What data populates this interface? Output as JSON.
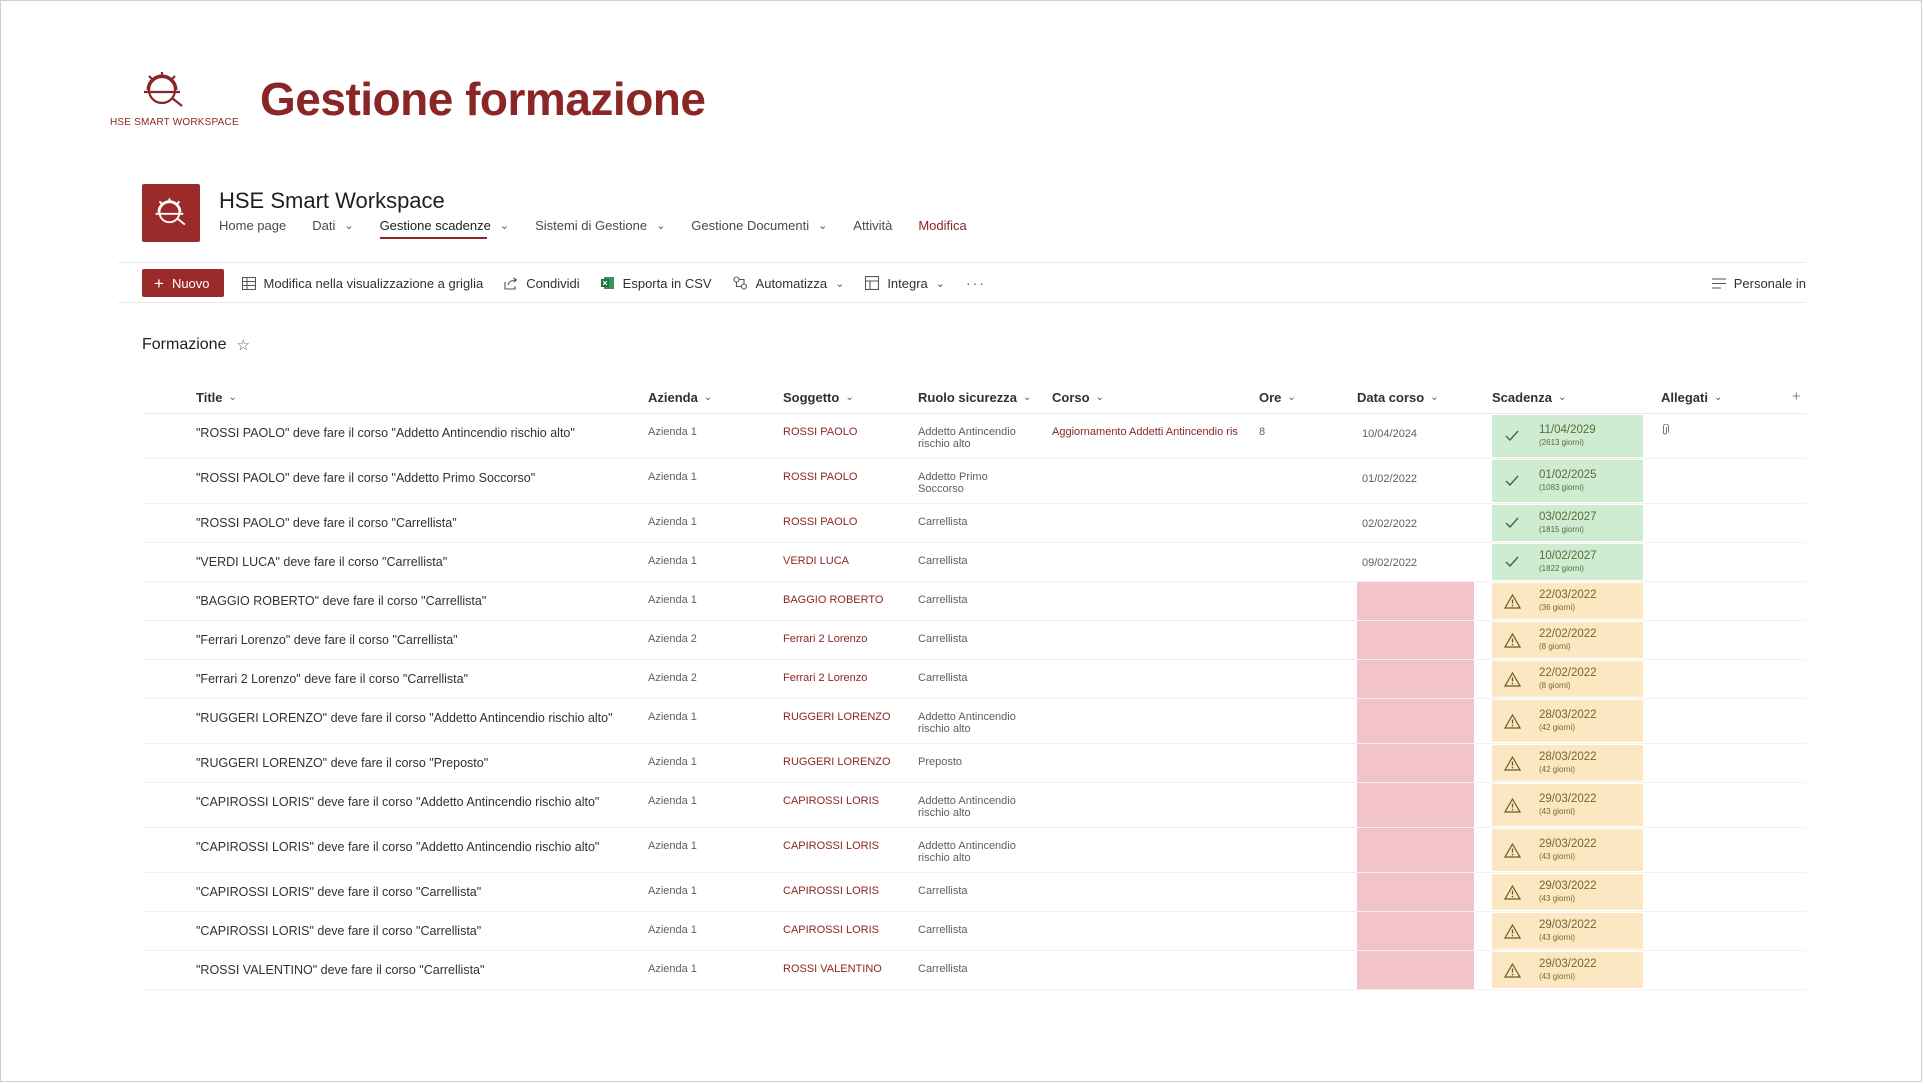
{
  "brand": {
    "text": "HSE SMART WORKSPACE"
  },
  "page_heading": "Gestione formazione",
  "site": {
    "title": "HSE Smart Workspace",
    "nav": [
      {
        "label": "Home page",
        "has_menu": false
      },
      {
        "label": "Dati",
        "has_menu": true
      },
      {
        "label": "Gestione scadenze",
        "has_menu": true,
        "active": true
      },
      {
        "label": "Sistemi di Gestione",
        "has_menu": true
      },
      {
        "label": "Gestione Documenti",
        "has_menu": true
      },
      {
        "label": "Attività",
        "has_menu": false
      },
      {
        "label": "Modifica",
        "has_menu": false
      }
    ]
  },
  "commands": {
    "new": "Nuovo",
    "grid_edit": "Modifica nella visualizzazione a griglia",
    "share": "Condividi",
    "export": "Esporta in CSV",
    "automate": "Automatizza",
    "integrate": "Integra",
    "more": "···",
    "view": "Personale in"
  },
  "list": {
    "title": "Formazione",
    "columns": {
      "title": "Title",
      "azienda": "Azienda",
      "soggetto": "Soggetto",
      "ruolo": "Ruolo sicurezza",
      "corso": "Corso",
      "ore": "Ore",
      "data": "Data corso",
      "scadenza": "Scadenza",
      "allegati": "Allegati",
      "add": "+"
    },
    "rows": [
      {
        "title": "\"ROSSI PAOLO\" deve fare il corso \"Addetto Antincendio rischio alto\"",
        "azienda": "Azienda 1",
        "soggetto": "ROSSI PAOLO",
        "ruolo": "Addetto Antincendio rischio alto",
        "corso": "Aggiornamento Addetti Antincendio ris",
        "ore": "8",
        "data": "10/04/2024",
        "scadenza": "11/04/2029",
        "giorni": "(2613 giorni)",
        "status": "ok",
        "allegato": true,
        "tall": true
      },
      {
        "title": "\"ROSSI PAOLO\" deve fare il corso \"Addetto Primo Soccorso\"",
        "azienda": "Azienda 1",
        "soggetto": "ROSSI PAOLO",
        "ruolo": "Addetto Primo Soccorso",
        "corso": "",
        "ore": "",
        "data": "01/02/2022",
        "scadenza": "01/02/2025",
        "giorni": "(1083 giorni)",
        "status": "ok",
        "allegato": false,
        "tall": true
      },
      {
        "title": "\"ROSSI PAOLO\" deve fare il corso \"Carrellista\"",
        "azienda": "Azienda 1",
        "soggetto": "ROSSI PAOLO",
        "ruolo": "Carrellista",
        "corso": "",
        "ore": "",
        "data": "02/02/2022",
        "scadenza": "03/02/2027",
        "giorni": "(1815 giorni)",
        "status": "ok",
        "allegato": false,
        "tall": false
      },
      {
        "title": "\"VERDI LUCA\" deve fare il corso \"Carrellista\"",
        "azienda": "Azienda 1",
        "soggetto": "VERDI LUCA",
        "ruolo": "Carrellista",
        "corso": "",
        "ore": "",
        "data": "09/02/2022",
        "scadenza": "10/02/2027",
        "giorni": "(1822 giorni)",
        "status": "ok",
        "allegato": false,
        "tall": false
      },
      {
        "title": "\"BAGGIO ROBERTO\" deve fare il corso \"Carrellista\"",
        "azienda": "Azienda 1",
        "soggetto": "BAGGIO ROBERTO",
        "ruolo": "Carrellista",
        "corso": "",
        "ore": "",
        "data": "",
        "scadenza": "22/03/2022",
        "giorni": "(36 giorni)",
        "status": "warn",
        "allegato": false,
        "tall": false
      },
      {
        "title": "\"Ferrari Lorenzo\" deve fare il corso \"Carrellista\"",
        "azienda": "Azienda 2",
        "soggetto": "Ferrari 2 Lorenzo",
        "ruolo": "Carrellista",
        "corso": "",
        "ore": "",
        "data": "",
        "scadenza": "22/02/2022",
        "giorni": "(8 giorni)",
        "status": "warn",
        "allegato": false,
        "tall": false
      },
      {
        "title": "\"Ferrari 2 Lorenzo\" deve fare il corso \"Carrellista\"",
        "azienda": "Azienda 2",
        "soggetto": "Ferrari 2 Lorenzo",
        "ruolo": "Carrellista",
        "corso": "",
        "ore": "",
        "data": "",
        "scadenza": "22/02/2022",
        "giorni": "(8 giorni)",
        "status": "warn",
        "allegato": false,
        "tall": false
      },
      {
        "title": "\"RUGGERI LORENZO\" deve fare il corso \"Addetto Antincendio rischio alto\"",
        "azienda": "Azienda 1",
        "soggetto": "RUGGERI LORENZO",
        "ruolo": "Addetto Antincendio rischio alto",
        "corso": "",
        "ore": "",
        "data": "",
        "scadenza": "28/03/2022",
        "giorni": "(42 giorni)",
        "status": "warn",
        "allegato": false,
        "tall": true
      },
      {
        "title": "\"RUGGERI LORENZO\" deve fare il corso \"Preposto\"",
        "azienda": "Azienda 1",
        "soggetto": "RUGGERI LORENZO",
        "ruolo": "Preposto",
        "corso": "",
        "ore": "",
        "data": "",
        "scadenza": "28/03/2022",
        "giorni": "(42 giorni)",
        "status": "warn",
        "allegato": false,
        "tall": false
      },
      {
        "title": "\"CAPIROSSI LORIS\" deve fare il corso \"Addetto Antincendio rischio alto\"",
        "azienda": "Azienda 1",
        "soggetto": "CAPIROSSI LORIS",
        "ruolo": "Addetto Antincendio rischio alto",
        "corso": "",
        "ore": "",
        "data": "",
        "scadenza": "29/03/2022",
        "giorni": "(43 giorni)",
        "status": "warn",
        "allegato": false,
        "tall": true
      },
      {
        "title": "\"CAPIROSSI LORIS\" deve fare il corso \"Addetto Antincendio rischio alto\"",
        "azienda": "Azienda 1",
        "soggetto": "CAPIROSSI LORIS",
        "ruolo": "Addetto Antincendio rischio alto",
        "corso": "",
        "ore": "",
        "data": "",
        "scadenza": "29/03/2022",
        "giorni": "(43 giorni)",
        "status": "warn",
        "allegato": false,
        "tall": true
      },
      {
        "title": "\"CAPIROSSI LORIS\" deve fare il corso \"Carrellista\"",
        "azienda": "Azienda 1",
        "soggetto": "CAPIROSSI LORIS",
        "ruolo": "Carrellista",
        "corso": "",
        "ore": "",
        "data": "",
        "scadenza": "29/03/2022",
        "giorni": "(43 giorni)",
        "status": "warn",
        "allegato": false,
        "tall": false
      },
      {
        "title": "\"CAPIROSSI LORIS\" deve fare il corso \"Carrellista\"",
        "azienda": "Azienda 1",
        "soggetto": "CAPIROSSI LORIS",
        "ruolo": "Carrellista",
        "corso": "",
        "ore": "",
        "data": "",
        "scadenza": "29/03/2022",
        "giorni": "(43 giorni)",
        "status": "warn",
        "allegato": false,
        "tall": false
      },
      {
        "title": "\"ROSSI VALENTINO\" deve fare il corso \"Carrellista\"",
        "azienda": "Azienda 1",
        "soggetto": "ROSSI VALENTINO",
        "ruolo": "Carrellista",
        "corso": "",
        "ore": "",
        "data": "",
        "scadenza": "29/03/2022",
        "giorni": "(43 giorni)",
        "status": "warn",
        "allegato": false,
        "tall": false
      }
    ]
  },
  "colors": {
    "brand": "#8b2626",
    "ok": "#cdecd1",
    "warn": "#fbe7c1",
    "missing": "#f2c3c7"
  }
}
